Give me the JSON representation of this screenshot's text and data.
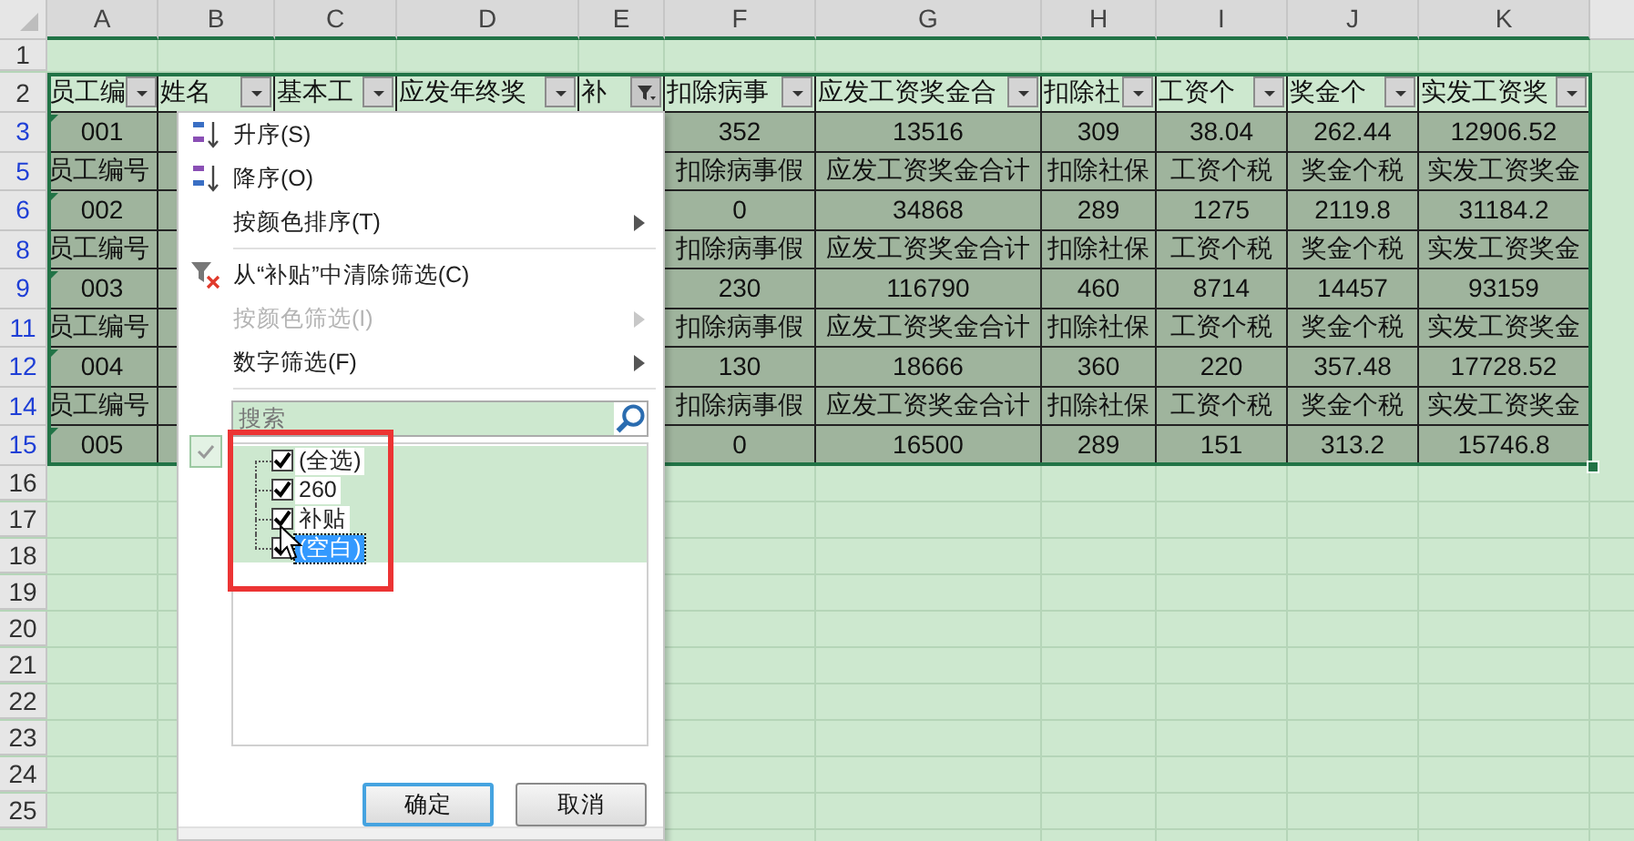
{
  "sheet": {
    "columns": [
      "A",
      "B",
      "C",
      "D",
      "E",
      "F",
      "G",
      "H",
      "I",
      "J",
      "K"
    ],
    "rows": [
      {
        "number": "1",
        "kind": "blank",
        "filtered": false
      },
      {
        "number": "2",
        "kind": "filter_header",
        "filtered": false,
        "cells": [
          {
            "text": "员工编",
            "filtered": false
          },
          {
            "text": "姓名",
            "filtered": false
          },
          {
            "text": "基本工",
            "filtered": false
          },
          {
            "text": "应发年终奖",
            "filtered": false
          },
          {
            "text": "补",
            "filtered": true
          },
          {
            "text": "扣除病事",
            "filtered": false
          },
          {
            "text": "应发工资奖金合",
            "filtered": false
          },
          {
            "text": "扣除社",
            "filtered": false
          },
          {
            "text": "工资个",
            "filtered": false
          },
          {
            "text": "奖金个",
            "filtered": false
          },
          {
            "text": "实发工资奖",
            "filtered": false
          }
        ]
      },
      {
        "number": "3",
        "kind": "data",
        "filtered": true,
        "cells": [
          "001",
          "352",
          "13516",
          "309",
          "38.04",
          "262.44",
          "12906.52"
        ]
      },
      {
        "number": "5",
        "kind": "label",
        "filtered": true,
        "cells": [
          "员工编号",
          "扣除病事假",
          "应发工资奖金合计",
          "扣除社保",
          "工资个税",
          "奖金个税",
          "实发工资奖金"
        ]
      },
      {
        "number": "6",
        "kind": "data",
        "filtered": true,
        "cells": [
          "002",
          "0",
          "34868",
          "289",
          "1275",
          "2119.8",
          "31184.2"
        ]
      },
      {
        "number": "8",
        "kind": "label",
        "filtered": true,
        "cells": [
          "员工编号",
          "扣除病事假",
          "应发工资奖金合计",
          "扣除社保",
          "工资个税",
          "奖金个税",
          "实发工资奖金"
        ]
      },
      {
        "number": "9",
        "kind": "data",
        "filtered": true,
        "cells": [
          "003",
          "230",
          "116790",
          "460",
          "8714",
          "14457",
          "93159"
        ]
      },
      {
        "number": "11",
        "kind": "label",
        "filtered": true,
        "cells": [
          "员工编号",
          "扣除病事假",
          "应发工资奖金合计",
          "扣除社保",
          "工资个税",
          "奖金个税",
          "实发工资奖金"
        ]
      },
      {
        "number": "12",
        "kind": "data",
        "filtered": true,
        "cells": [
          "004",
          "130",
          "18666",
          "360",
          "220",
          "357.48",
          "17728.52"
        ]
      },
      {
        "number": "14",
        "kind": "label",
        "filtered": true,
        "cells": [
          "员工编号",
          "扣除病事假",
          "应发工资奖金合计",
          "扣除社保",
          "工资个税",
          "奖金个税",
          "实发工资奖金"
        ]
      },
      {
        "number": "15",
        "kind": "data",
        "filtered": true,
        "cells": [
          "005",
          "0",
          "16500",
          "289",
          "151",
          "313.2",
          "15746.8"
        ]
      },
      {
        "number": "16",
        "kind": "blank",
        "filtered": false
      },
      {
        "number": "17",
        "kind": "blank",
        "filtered": false
      },
      {
        "number": "18",
        "kind": "blank",
        "filtered": false
      },
      {
        "number": "19",
        "kind": "blank",
        "filtered": false
      },
      {
        "number": "20",
        "kind": "blank",
        "filtered": false
      },
      {
        "number": "21",
        "kind": "blank",
        "filtered": false
      },
      {
        "number": "22",
        "kind": "blank",
        "filtered": false
      },
      {
        "number": "23",
        "kind": "blank",
        "filtered": false
      },
      {
        "number": "24",
        "kind": "blank",
        "filtered": false
      },
      {
        "number": "25",
        "kind": "blank",
        "filtered": false
      }
    ]
  },
  "filter_menu": {
    "items": [
      {
        "kind": "sort_asc",
        "label": "升序(S)",
        "disabled": false,
        "submenu": false
      },
      {
        "kind": "sort_desc",
        "label": "降序(O)",
        "disabled": false,
        "submenu": false
      },
      {
        "kind": "plain",
        "label": "按颜色排序(T)",
        "disabled": false,
        "submenu": true
      },
      {
        "kind": "separator"
      },
      {
        "kind": "clear_filter",
        "label": "从“补贴”中清除筛选(C)",
        "disabled": false,
        "submenu": false
      },
      {
        "kind": "plain",
        "label": "按颜色筛选(I)",
        "disabled": true,
        "submenu": true
      },
      {
        "kind": "plain",
        "label": "数字筛选(F)",
        "disabled": false,
        "submenu": true
      },
      {
        "kind": "separator"
      }
    ],
    "search": {
      "placeholder": "搜索"
    },
    "values": [
      {
        "label": "(全选)",
        "checked": true,
        "selected": false
      },
      {
        "label": "260",
        "checked": true,
        "selected": false
      },
      {
        "label": "补贴",
        "checked": true,
        "selected": false
      },
      {
        "label": "(空白)",
        "checked": true,
        "selected": true
      }
    ],
    "buttons": [
      {
        "label": "确定",
        "default": true
      },
      {
        "label": "取消",
        "default": false
      }
    ]
  }
}
